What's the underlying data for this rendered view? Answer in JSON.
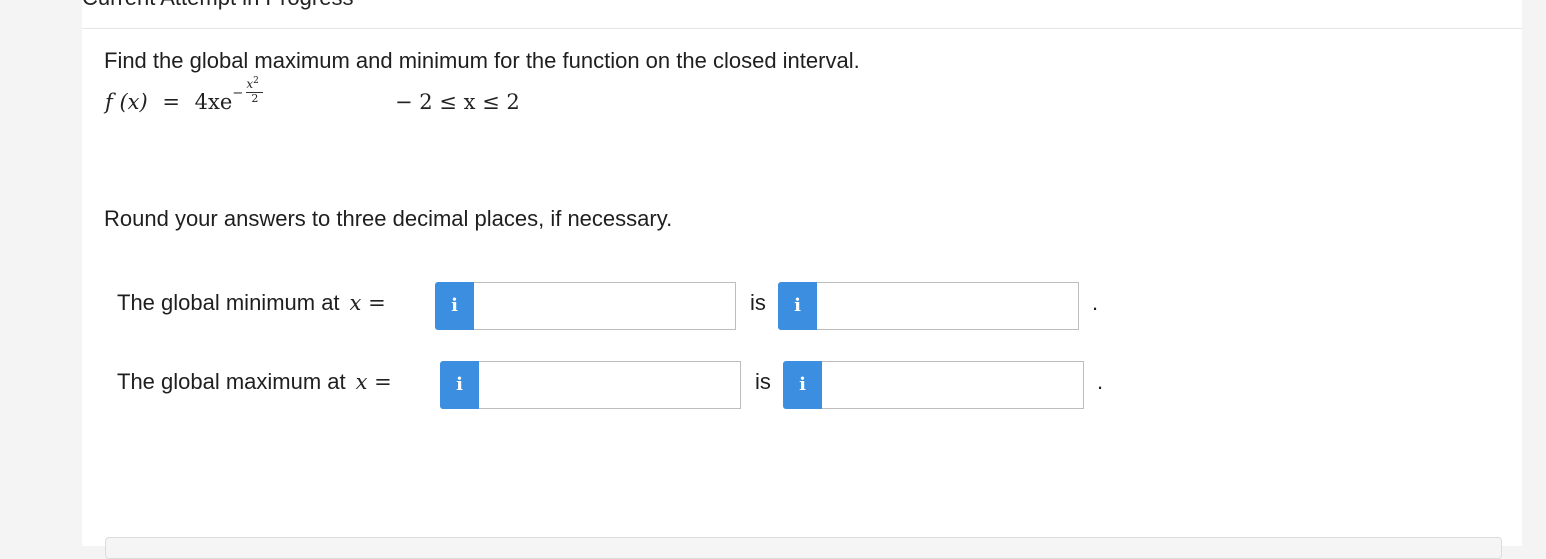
{
  "header": {
    "title": "Current Attempt in Progress"
  },
  "question": {
    "prompt": "Find the global maximum and minimum for the function on the closed interval.",
    "function_lhs": "f (x)",
    "equals": "=",
    "function_rhs": "4xe",
    "exponent_minus": "−",
    "exponent_numerator_base": "x",
    "exponent_numerator_power": "2",
    "exponent_denominator": "2",
    "interval": "− 2 ≤ x ≤ 2",
    "rounding_note": "Round your answers to three decimal places, if necessary."
  },
  "answers": {
    "min_label": "The global minimum at",
    "max_label": "The global maximum at",
    "x_eq": "x =",
    "is_label": "is",
    "info_icon": "i",
    "period": ".",
    "min_x_value": "",
    "min_value": "",
    "max_x_value": "",
    "max_value": ""
  },
  "colors": {
    "info_button": "#3b8ee0",
    "input_border": "#bdbdbd"
  },
  "icons": {
    "info": "info-icon"
  }
}
